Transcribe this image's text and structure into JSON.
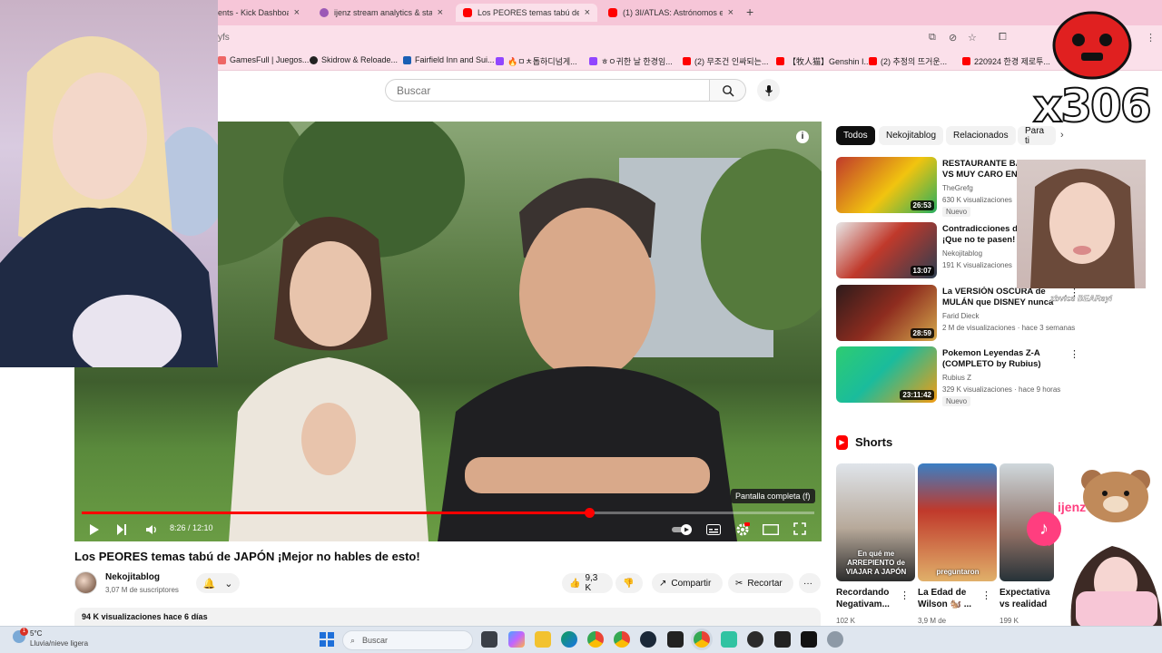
{
  "browser": {
    "tabs": [
      {
        "label": "ents - Kick Dashboard",
        "color": "#53fc18"
      },
      {
        "label": "ijenz stream analytics & stats b",
        "color": "#9b59b6"
      },
      {
        "label": "Los PEORES temas tabú de JAPÓ",
        "color": "#ff0000",
        "active": true
      },
      {
        "label": "(1) 3I/ATLAS: Astrónomos encu",
        "color": "#ff0000"
      }
    ],
    "new_tab": "+",
    "url": "yfs",
    "bookmarks": [
      {
        "label": "GamesFull | Juegos...",
        "color": "#e66"
      },
      {
        "label": "Skidrow & Reloade...",
        "color": "#222"
      },
      {
        "label": "Fairfield Inn and Sui...",
        "color": "#1a5fb4"
      },
      {
        "label": "🔥ㅁㅊ톱하디넘게...",
        "color": "#9146ff"
      },
      {
        "label": "ㅎㅇ귀한 날 한경임...",
        "color": "#9146ff"
      },
      {
        "label": "(2) 무조건 인싸되는...",
        "color": "#ff0000"
      },
      {
        "label": "【牧人猫】Genshin I...",
        "color": "#ff0000"
      },
      {
        "label": "(2) 추정의 뜨거운...",
        "color": "#ff0000"
      },
      {
        "label": "220924 한경 제로투...",
        "color": "#ff0000"
      }
    ]
  },
  "header": {
    "search_placeholder": "Buscar"
  },
  "player": {
    "time": "8:26 / 12:10",
    "progress": 0.693,
    "tooltip": "Pantalla completa (f)",
    "info": "i"
  },
  "video": {
    "title": "Los PEORES temas tabú de JAPÓN ¡Mejor no hables de esto!",
    "channel": "Nekojitablog",
    "subscribers": "3,07 M de suscriptores",
    "likes": "9,3 K",
    "share": "Compartir",
    "clip": "Recortar",
    "more": "···",
    "views_date": "94 K visualizaciones  hace 6 días"
  },
  "sidebar": {
    "chips": [
      "Todos",
      "Nekojitablog",
      "Relacionados",
      "Para ti"
    ],
    "recommendations": [
      {
        "title": "RESTAURANTE BARATO VS MUY CARO EN CHINA",
        "channel": "TheGrefg",
        "meta": "630 K visualizaciones",
        "badge": "Nuevo",
        "duration": "26:53"
      },
      {
        "title": "Contradicciones de JAPÓN ¡Que no te pasen!",
        "channel": "Nekojitablog",
        "meta": "191 K visualizaciones",
        "badge": "",
        "duration": "13:07"
      },
      {
        "title": "La VERSIÓN OSCURA de MULÁN que DISNEY nunca ...",
        "channel": "Farid Dieck",
        "meta": "2 M de visualizaciones · hace 3 semanas",
        "badge": "",
        "duration": "28:59"
      },
      {
        "title": "Pokemon Leyendas Z-A (COMPLETO by Rubius)",
        "channel": "Rubius Z",
        "meta": "329 K visualizaciones · hace 9 horas",
        "badge": "Nuevo",
        "duration": "23:11:42"
      }
    ],
    "shorts_title": "Shorts",
    "shorts": [
      {
        "title": "Recordando Negativam...",
        "views": "102 K",
        "caption": "En qué me ARREPIENTO de VIAJAR A JAPÓN"
      },
      {
        "title": "La Edad de Wilson 🐿️ ...",
        "views": "3,9 M de",
        "caption": "preguntaron"
      },
      {
        "title": "Expectativa vs realidad",
        "views": "199 K",
        "caption": ""
      }
    ]
  },
  "overlays": {
    "count": "x306",
    "tiktok_handle": "zbvics BEARsyl",
    "bear_name": "ijenz"
  },
  "taskbar": {
    "temperature": "5°C",
    "weather": "Lluvia/nieve ligera",
    "badge": "1",
    "search": "Buscar"
  }
}
